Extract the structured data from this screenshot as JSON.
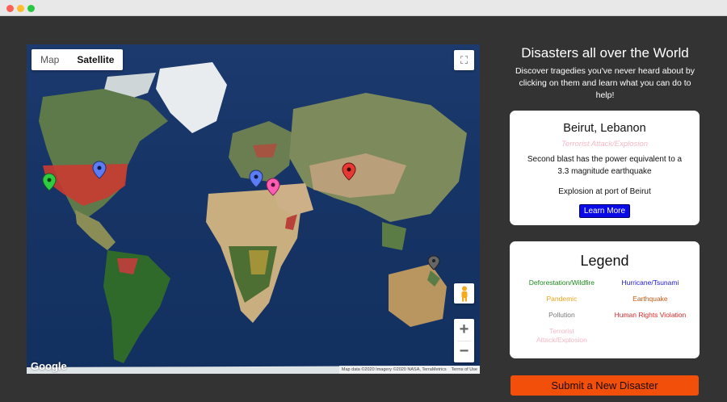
{
  "colors": {
    "background": "#333333",
    "submit": "#f24f0b",
    "learn_more": "#0a0ae6"
  },
  "map": {
    "types": [
      "Map",
      "Satellite"
    ],
    "active_type": "Satellite",
    "google_label": "Google",
    "attribution": "Map data ©2020 Imagery ©2020 NASA, TerraMetrics",
    "terms": "Terms of Use",
    "zoom_in": "+",
    "zoom_out": "−",
    "fullscreen_icon": "⛶",
    "markers": [
      {
        "name": "marker-us-west",
        "color": "#2ecc40"
      },
      {
        "name": "marker-us-east",
        "color": "#5b7cf5"
      },
      {
        "name": "marker-europe",
        "color": "#5b7cf5"
      },
      {
        "name": "marker-lebanon",
        "color": "#ff5db1"
      },
      {
        "name": "marker-asia",
        "color": "#e53935"
      },
      {
        "name": "marker-australia",
        "color": "#666666"
      }
    ]
  },
  "header": {
    "title": "Disasters all over the World",
    "subtitle": "Discover tragedies you've never heard about by clicking on them and learn what you can do to help!"
  },
  "info": {
    "place": "Beirut, Lebanon",
    "category": "Terrorist Attack/Explosion",
    "description": "Second blast has the power equivalent to a 3.3 magnitude earthquake",
    "summary": "Explosion at port of Beirut",
    "learn_more": "Learn More"
  },
  "legend": {
    "title": "Legend",
    "items": [
      {
        "label": "Deforestation/Wildfire",
        "color": "#1b8c1b"
      },
      {
        "label": "Hurricane/Tsunami",
        "color": "#1a1ae6"
      },
      {
        "label": "Pandemic",
        "color": "#f0a21a"
      },
      {
        "label": "Earthquake",
        "color": "#c85a14"
      },
      {
        "label": "Pollution",
        "color": "#777777"
      },
      {
        "label": "Human Rights Violation",
        "color": "#e0282a"
      },
      {
        "label": "Terrorist Attack/Explosion",
        "color": "#f5b8c7"
      }
    ]
  },
  "submit_label": "Submit a New Disaster"
}
